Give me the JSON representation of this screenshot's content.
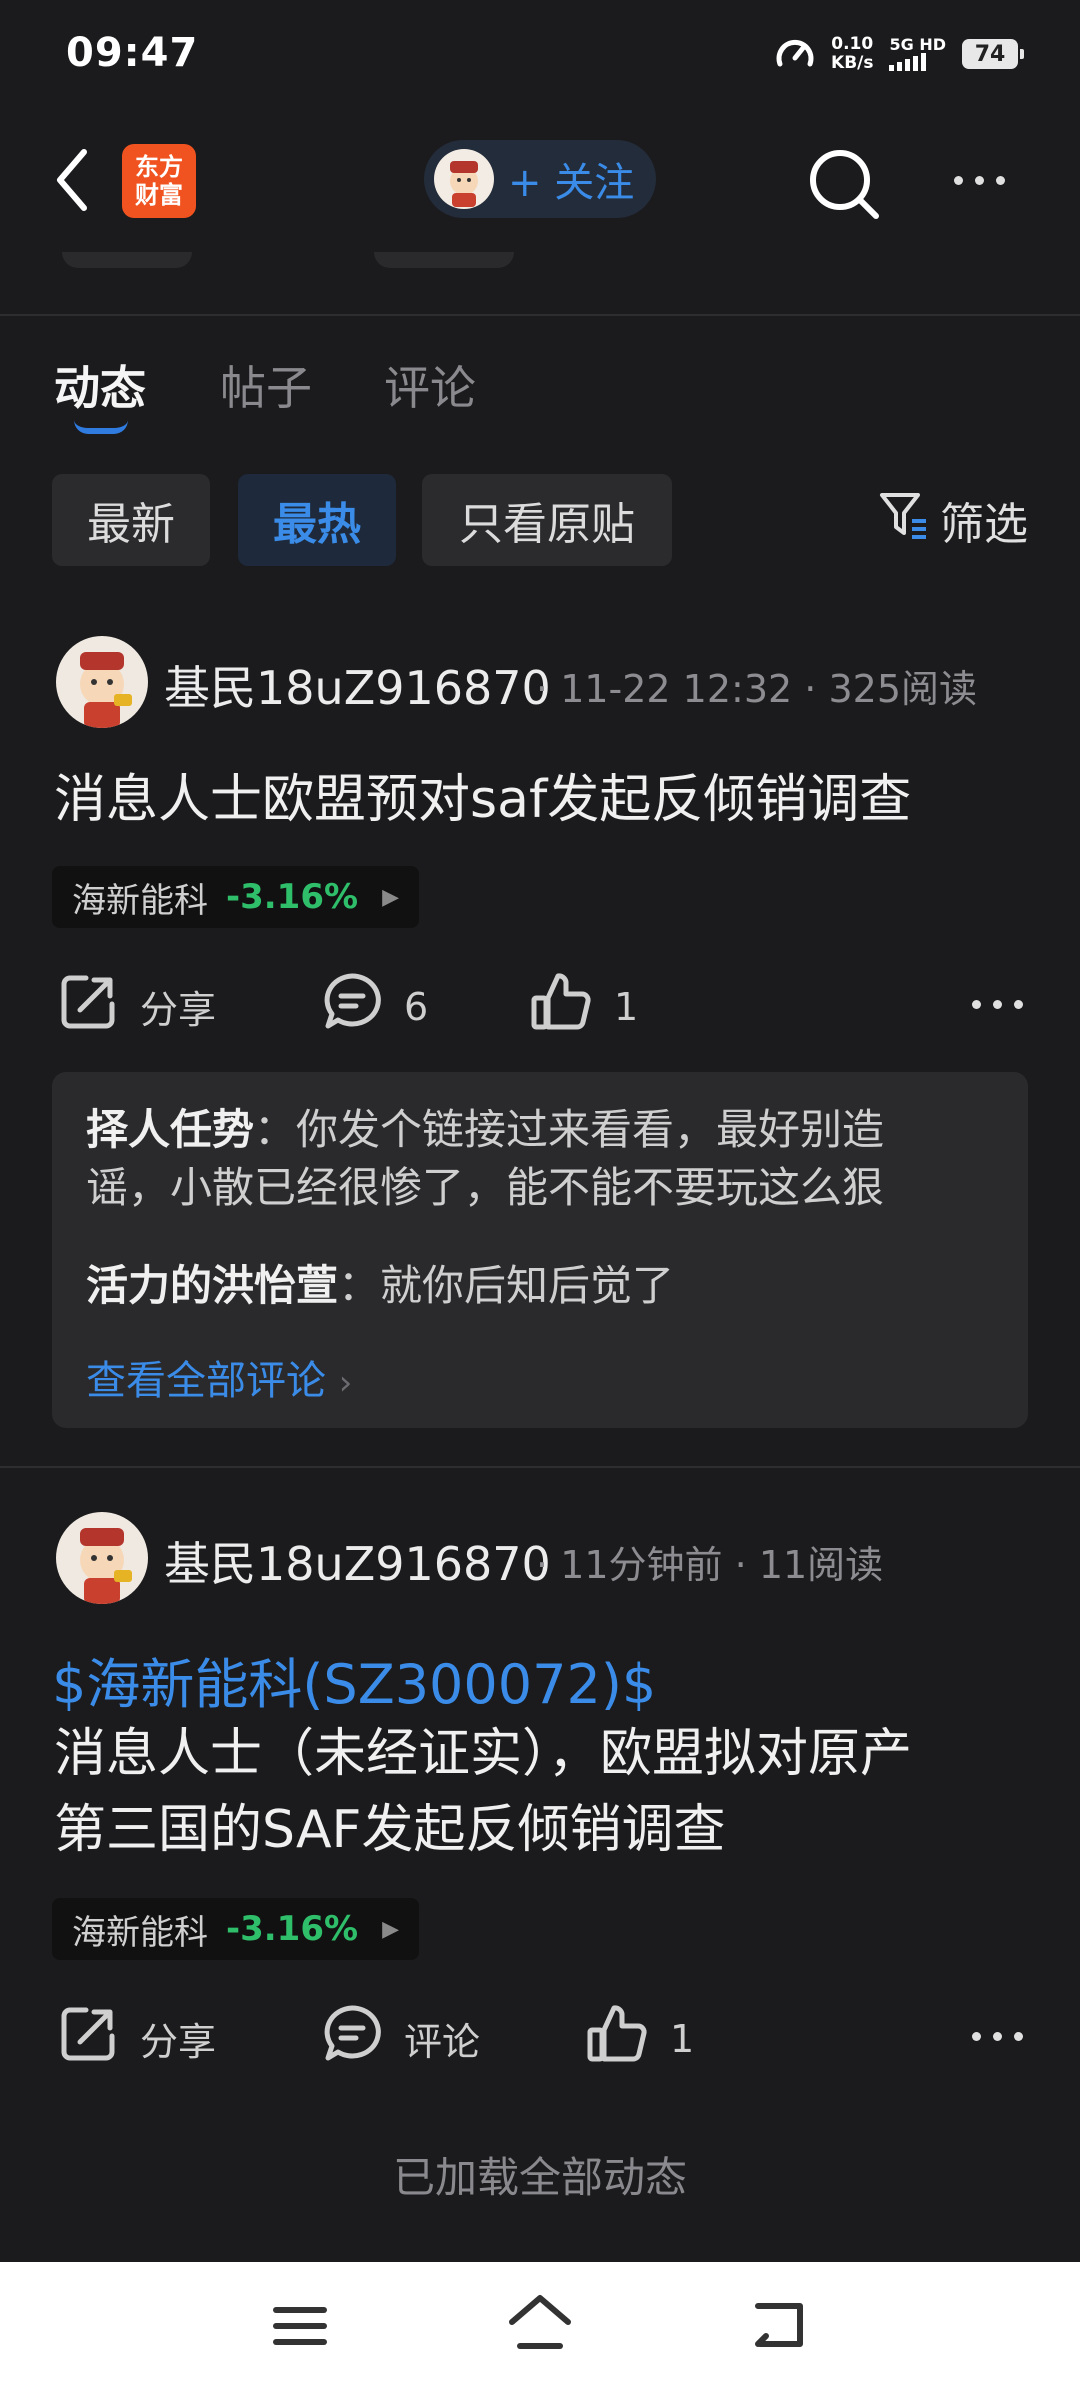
{
  "status_bar": {
    "time": "09:47",
    "speed_value": "0.10",
    "speed_unit": "KB/s",
    "network": "5G HD",
    "battery": "74"
  },
  "header": {
    "logo_line1": "东方",
    "logo_line2": "财富",
    "follow_label": "+ 关注"
  },
  "tabs": [
    {
      "label": "动态",
      "active": true
    },
    {
      "label": "帖子",
      "active": false
    },
    {
      "label": "评论",
      "active": false
    }
  ],
  "filters": {
    "chips": [
      {
        "label": "最新",
        "active": false
      },
      {
        "label": "最热",
        "active": true
      },
      {
        "label": "只看原贴",
        "active": false
      }
    ],
    "filter_label": "筛选"
  },
  "posts": [
    {
      "username": "基民18uZ916870",
      "time": "11-22 12:32",
      "reads": "325阅读",
      "stock_link": "",
      "title_lines": [
        "消息人士欧盟预对saf发起反倾销调查"
      ],
      "stock_name": "海新能科",
      "stock_change": "-3.16%",
      "share_label": "分享",
      "comment_label": "6",
      "like_count": "1",
      "comments": [
        {
          "author": "择人任势",
          "text_line1": "你发个链接过来看看，最好别造",
          "text_line2": "谣，小散已经很惨了，能不能不要玩这么狠"
        },
        {
          "author": "活力的洪怡萱",
          "text_line1": "就你后知后觉了"
        }
      ],
      "view_all": "查看全部评论"
    },
    {
      "username": "基民18uZ916870",
      "time": "11分钟前",
      "reads": "11阅读",
      "stock_link": "$海新能科(SZ300072)$",
      "title_lines": [
        "消息人士（未经证实），欧盟拟对原产",
        "第三国的SAF发起反倾销调查"
      ],
      "stock_name": "海新能科",
      "stock_change": "-3.16%",
      "share_label": "分享",
      "comment_label": "评论",
      "like_count": "1"
    }
  ],
  "footer_text": "已加载全部动态",
  "colors": {
    "background": "#1b1b1d",
    "accent_blue": "#3a8ce8",
    "stock_green": "#2fbf6a",
    "logo_orange": "#f0531f"
  },
  "icons": [
    "back-icon",
    "search-icon",
    "more-icon",
    "filter-icon",
    "share-icon",
    "comment-icon",
    "like-icon",
    "menu-icon",
    "home-icon",
    "back-nav-icon"
  ]
}
